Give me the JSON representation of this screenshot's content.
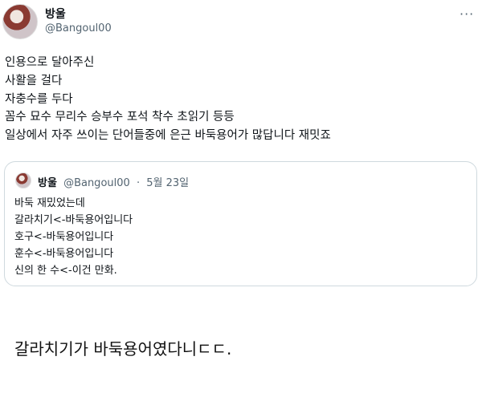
{
  "tweet": {
    "display_name": "방울",
    "handle": "@Bangoul00",
    "more_icon": "more-dots-icon",
    "lines": [
      "인용으로 달아주신",
      "사활을 걸다",
      "자충수를 두다",
      "꼼수 묘수 무리수 승부수 포석 착수 초읽기 등등",
      "일상에서 자주 쓰이는 단어들중에 은근 바둑용어가 많답니다 재밋죠"
    ]
  },
  "quote": {
    "display_name": "방울",
    "handle": "@Bangoul00",
    "separator": "·",
    "date": "5월 23일",
    "lines": [
      "바둑 재밌었는데",
      "갈라치기<-바둑용어입니다",
      "호구<-바둑용어입니다",
      "훈수<-바둑용어입니다",
      "신의 한 수<-이건 만화."
    ]
  },
  "comment": "갈라치기가 바둑용어였다니ㄷㄷ."
}
